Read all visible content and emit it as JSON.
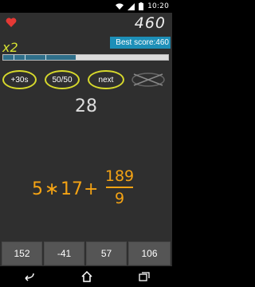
{
  "status_bar": {
    "time": "10:20"
  },
  "game": {
    "score": "460",
    "best_score": "Best score:460",
    "multiplier": "x2",
    "progress_fraction": 0.44,
    "timer": "28"
  },
  "powerups": {
    "plus_time": "+30s",
    "fifty_fifty": "50/50",
    "next": "next"
  },
  "expression": {
    "a": "5",
    "op1": "∗",
    "b": "17",
    "op2": "+",
    "numerator": "189",
    "denominator": "9"
  },
  "answers": [
    "152",
    "-41",
    "57",
    "106"
  ],
  "colors": {
    "background": "#2f2f2f",
    "accent_orange": "#f4a314",
    "accent_yellow": "#d7d92c",
    "best_score_bg": "#1d8fb8",
    "heart": "#e53935",
    "answer_bg": "#555555"
  },
  "icons": [
    "heart-icon",
    "crossed-out-icon",
    "wifi-icon",
    "signal-icon",
    "battery-icon",
    "back-icon",
    "home-icon",
    "recents-icon"
  ]
}
